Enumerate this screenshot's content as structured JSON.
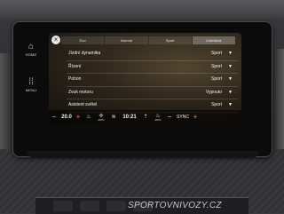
{
  "side_keys": [
    {
      "label": "HOME",
      "icon": "home-icon",
      "glyph": "⌂"
    },
    {
      "label": "MENU",
      "icon": "apps-grid-icon",
      "glyph": "⁞⁞"
    }
  ],
  "tabs": [
    "Eco",
    "Normal",
    "Sport",
    "Individual"
  ],
  "active_tab": 3,
  "settings": [
    {
      "label": "Jízdní dynamika",
      "value": "Sport"
    },
    {
      "label": "Řízení",
      "value": "Sport"
    },
    {
      "label": "Pohon",
      "value": "Sport"
    },
    {
      "label": "Zvuk motoru",
      "value": "Vypnuto"
    },
    {
      "label": "Asistent světel",
      "value": "Sport"
    }
  ],
  "climate": {
    "minus": "−",
    "plus": "+",
    "temp": "20.0",
    "clock": "10:21",
    "sync": "SYNC",
    "seat_heat_label": "AUTO",
    "fan_label": "AUTO"
  },
  "colors": {
    "plus_accent": "#ff3355"
  },
  "watermark": "SPORTOVNIVOZY.CZ"
}
